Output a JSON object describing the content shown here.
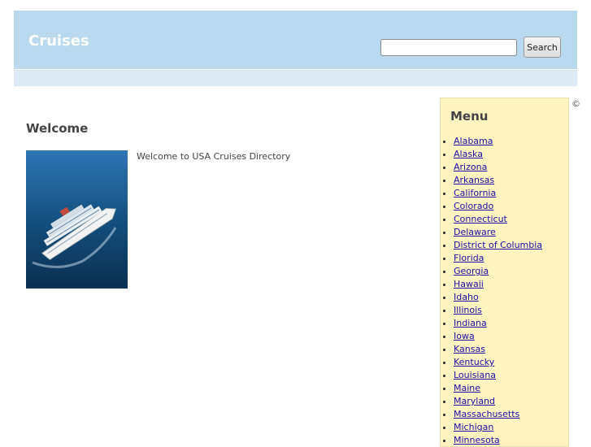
{
  "header": {
    "site_title": "Cruises",
    "search_placeholder": "",
    "search_button": "Search"
  },
  "main": {
    "heading": "Welcome",
    "intro": "Welcome to USA Cruises Directory"
  },
  "copyright_symbol": "©",
  "menu": {
    "title": "Menu",
    "items": [
      "Alabama",
      "Alaska",
      "Arizona",
      "Arkansas",
      "California",
      "Colorado",
      "Connecticut",
      "Delaware",
      "District of Columbia",
      "Florida",
      "Georgia",
      "Hawaii",
      "Idaho",
      "Illinois",
      "Indiana",
      "Iowa",
      "Kansas",
      "Kentucky",
      "Louisiana",
      "Maine",
      "Maryland",
      "Massachusetts",
      "Michigan",
      "Minnesota"
    ]
  },
  "colors": {
    "header_bg": "#bad8ee",
    "subbar_bg": "#ddeaf5",
    "menu_bg": "#fff4c0",
    "link": "#1a0dab"
  }
}
